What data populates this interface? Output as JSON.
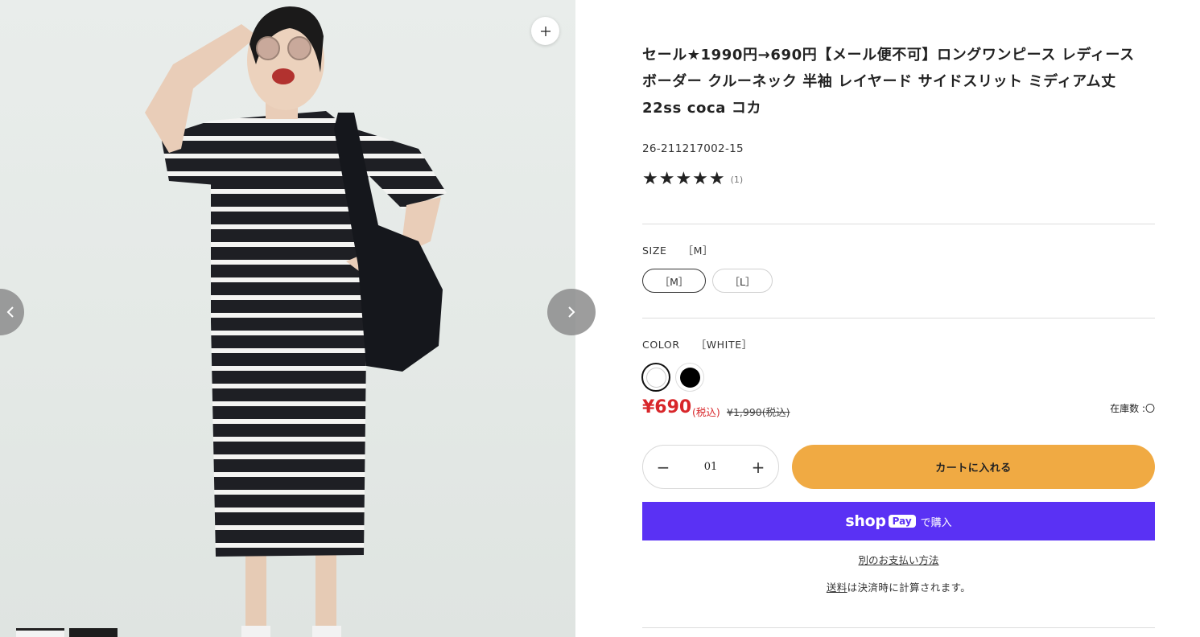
{
  "gallery": {
    "zoom_icon": "plus-icon",
    "prev_icon": "chevron-left-icon",
    "next_icon": "chevron-right-icon"
  },
  "product": {
    "title": "セール★1990円→690円【メール便不可】ロングワンピース レディース ボーダー クルーネック 半袖 レイヤード サイドスリット ミディアム丈 22ss coca コカ",
    "sku": "26-211217002-15",
    "rating": {
      "stars": "★★★★★",
      "value": 5,
      "max": 5,
      "count": "(1)"
    }
  },
  "size": {
    "label": "SIZE",
    "selected": "［M］",
    "options": [
      "［M］",
      "［L］"
    ]
  },
  "color": {
    "label": "COLOR",
    "selected": "［WHITE］",
    "options": [
      {
        "name": "WHITE",
        "hex": "#ffffff"
      },
      {
        "name": "BLACK",
        "hex": "#000000"
      }
    ]
  },
  "price": {
    "current": "¥690",
    "tax_note": "(税込)",
    "original": "¥1,990(税込)",
    "stock_label": "在庫数 :",
    "stock_value": "〇",
    "accent_color": "#d8262a"
  },
  "quantity": {
    "value": "01",
    "minus": "−",
    "plus": "+"
  },
  "buttons": {
    "add_to_cart": "カートに入れる",
    "cart_color": "#f0aa43",
    "shop_pay_word": "shop",
    "shop_pay_badge": "Pay",
    "shop_pay_suffix": "で購入",
    "shop_pay_color": "#5a31f4",
    "other_payment": "別のお支払い方法"
  },
  "shipping": {
    "link": "送料",
    "text": "は決済時に計算されます。"
  }
}
